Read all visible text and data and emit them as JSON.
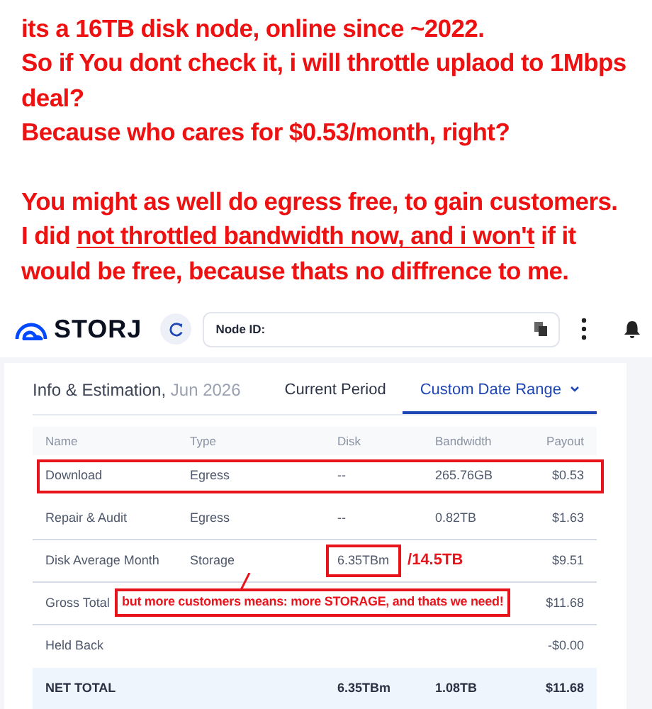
{
  "annotation": {
    "lines": [
      {
        "kind": "text",
        "text": "its a 16TB disk node, online since ~2022."
      },
      {
        "kind": "text",
        "text": "So if You dont check it, i will throttle uplaod to 1Mbps"
      },
      {
        "kind": "text",
        "text": "deal?"
      },
      {
        "kind": "text",
        "text": "Because who cares for $0.53/month, right?"
      },
      {
        "kind": "blank"
      },
      {
        "kind": "text",
        "text": "You might as well do egress free, to gain customers."
      },
      {
        "kind": "underline",
        "before": "I did ",
        "underlined": "not throttled bandwidth now, and i won't",
        "after": " if it"
      },
      {
        "kind": "text",
        "text": "would be free, because thats no diffrence to me."
      }
    ]
  },
  "header": {
    "logo_text": "STORJ",
    "node_id_label": "Node ID:"
  },
  "card": {
    "title": "Info & Estimation,",
    "period": "Jun 2026",
    "tabs": [
      {
        "label": "Current Period",
        "selected": false
      },
      {
        "label": "Custom Date Range",
        "selected": true,
        "dropdown": true
      }
    ],
    "table": {
      "columns": [
        "Name",
        "Type",
        "Disk",
        "Bandwidth",
        "Payout"
      ],
      "rows": [
        {
          "kind": "normal",
          "name": "Download",
          "type": "Egress",
          "disk": "--",
          "bandwidth": "265.76GB",
          "payout": "$0.53",
          "boxed": true
        },
        {
          "kind": "normal",
          "name": "Repair & Audit",
          "type": "Egress",
          "disk": "--",
          "bandwidth": "0.82TB",
          "payout": "$1.63"
        },
        {
          "kind": "normal",
          "name": "Disk Average Month",
          "type": "Storage",
          "disk": "6.35TBm",
          "payout": "$9.51",
          "disk_boxed": true,
          "disk_note": "/14.5TB"
        },
        {
          "kind": "normal",
          "name": "Gross Total",
          "payout": "$11.68",
          "callout": "but more customers means: more STORAGE, and thats we need!"
        },
        {
          "kind": "normal",
          "name": "Held Back",
          "payout": "-$0.00"
        },
        {
          "kind": "total",
          "name": "NET TOTAL",
          "disk": "6.35TBm",
          "bandwidth": "1.08TB",
          "payout": "$11.68"
        }
      ]
    }
  }
}
